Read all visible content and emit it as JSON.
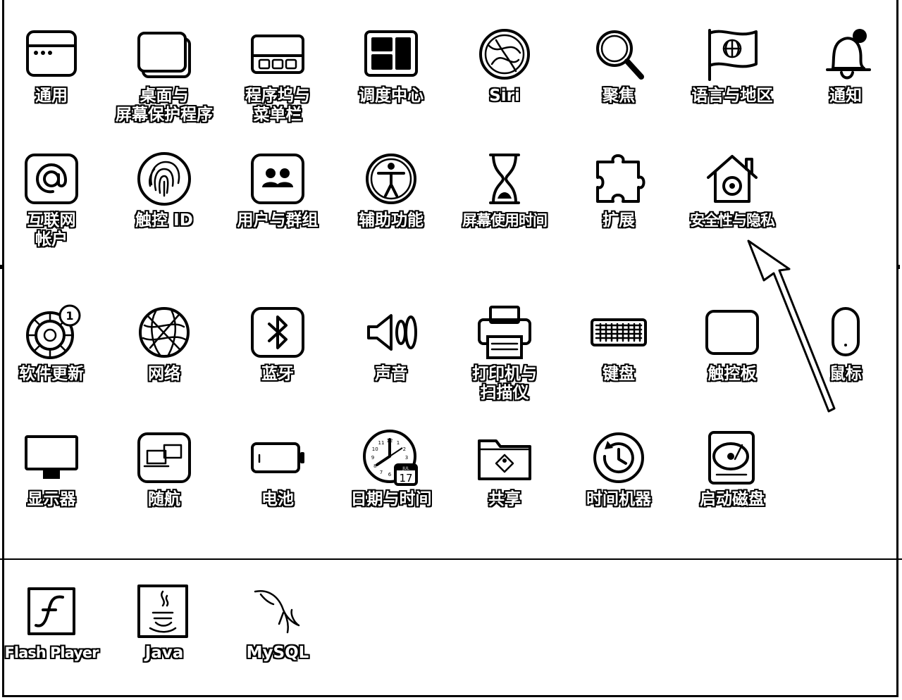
{
  "rows": [
    [
      {
        "id": "general",
        "icon": "window-icon",
        "label": [
          "通用"
        ]
      },
      {
        "id": "desktop",
        "icon": "desktop-icon",
        "label": [
          "桌面与",
          "屏幕保护程序"
        ]
      },
      {
        "id": "dock",
        "icon": "dock-icon",
        "label": [
          "程序坞与",
          "菜单栏"
        ]
      },
      {
        "id": "mission-control",
        "icon": "mission-control-icon",
        "label": [
          "调度中心"
        ]
      },
      {
        "id": "siri",
        "icon": "siri-icon",
        "label": [
          "Siri"
        ]
      },
      {
        "id": "spotlight",
        "icon": "magnifier-icon",
        "label": [
          "聚焦"
        ]
      },
      {
        "id": "language-region",
        "icon": "globe-flag-icon",
        "label": [
          "语言与地区"
        ]
      },
      {
        "id": "notifications",
        "icon": "bell-icon",
        "label": [
          "通知"
        ]
      }
    ],
    [
      {
        "id": "internet-accounts",
        "icon": "at-sign-icon",
        "label": [
          "互联网",
          "帐户"
        ]
      },
      {
        "id": "touch-id",
        "icon": "fingerprint-icon",
        "label": [
          "触控 ID"
        ]
      },
      {
        "id": "users-groups",
        "icon": "users-icon",
        "label": [
          "用户与群组"
        ]
      },
      {
        "id": "accessibility",
        "icon": "accessibility-icon",
        "label": [
          "辅助功能"
        ]
      },
      {
        "id": "screen-time",
        "icon": "hourglass-icon",
        "label": [
          "屏幕使用时间"
        ]
      },
      {
        "id": "extensions",
        "icon": "puzzle-icon",
        "label": [
          "扩展"
        ]
      },
      {
        "id": "security-privacy",
        "icon": "house-lock-icon",
        "label": [
          "安全性与隐私"
        ]
      }
    ],
    [
      {
        "id": "software-update",
        "icon": "gear-icon",
        "label": [
          "软件更新"
        ],
        "badge": "1"
      },
      {
        "id": "network",
        "icon": "network-globe-icon",
        "label": [
          "网络"
        ]
      },
      {
        "id": "bluetooth",
        "icon": "bluetooth-icon",
        "label": [
          "蓝牙"
        ]
      },
      {
        "id": "sound",
        "icon": "speaker-icon",
        "label": [
          "声音"
        ]
      },
      {
        "id": "printers-scanners",
        "icon": "printer-icon",
        "label": [
          "打印机与",
          "扫描仪"
        ]
      },
      {
        "id": "keyboard",
        "icon": "keyboard-icon",
        "label": [
          "键盘"
        ]
      },
      {
        "id": "trackpad",
        "icon": "trackpad-icon",
        "label": [
          "触控板"
        ]
      },
      {
        "id": "mouse",
        "icon": "mouse-icon",
        "label": [
          "鼠标"
        ]
      }
    ],
    [
      {
        "id": "displays",
        "icon": "monitor-icon",
        "label": [
          "显示器"
        ]
      },
      {
        "id": "sidecar",
        "icon": "sidecar-icon",
        "label": [
          "随航"
        ]
      },
      {
        "id": "battery",
        "icon": "battery-icon",
        "label": [
          "电池"
        ]
      },
      {
        "id": "date-time",
        "icon": "clock-icon",
        "label": [
          "日期与时间"
        ],
        "date_number": "17",
        "clock_numbers": [
          "12",
          "1",
          "2",
          "3",
          "4",
          "5",
          "6",
          "7",
          "8",
          "9",
          "10",
          "11"
        ],
        "calendar_month": "JUL"
      },
      {
        "id": "sharing",
        "icon": "shared-folder-icon",
        "label": [
          "共享"
        ]
      },
      {
        "id": "time-machine",
        "icon": "time-machine-icon",
        "label": [
          "时间机器"
        ]
      },
      {
        "id": "startup-disk",
        "icon": "hard-disk-icon",
        "label": [
          "启动磁盘"
        ]
      }
    ]
  ],
  "third_party": [
    {
      "id": "flash-player",
      "icon": "flash-icon",
      "label": [
        "Flash Player"
      ]
    },
    {
      "id": "java",
      "icon": "java-icon",
      "label": [
        "Java"
      ]
    },
    {
      "id": "mysql",
      "icon": "dolphin-icon",
      "label": [
        "MySQL"
      ]
    }
  ]
}
